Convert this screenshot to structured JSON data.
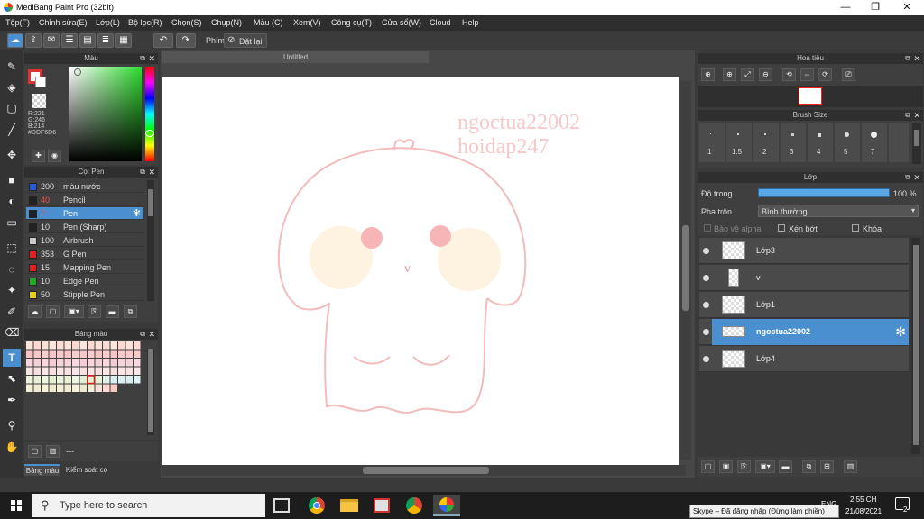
{
  "window": {
    "title": "MediBang Paint Pro (32bit)",
    "min": "—",
    "max": "❐",
    "close": "✕"
  },
  "menu": [
    "Tệp(F)",
    "Chỉnh sửa(E)",
    "Lớp(L)",
    "Bộ lọc(R)",
    "Chọn(S)",
    "Chụp(N)",
    "Màu (C)",
    "Xem(V)",
    "Công cụ(T)",
    "Cửa sổ(W)",
    "Cloud",
    "Help"
  ],
  "toolbar": {
    "keys_label": "Phím",
    "reset_label": "Đặt lại"
  },
  "color_panel": {
    "title": "Màu",
    "r": "R:221",
    "g": "G:246",
    "b": "B:214",
    "hex": "#DDF6D6"
  },
  "brush_panel": {
    "title": "Cọ: Pen",
    "items": [
      {
        "size": "200",
        "name": "màu nước",
        "color": "#2a57d9"
      },
      {
        "size": "40",
        "name": "Pencil",
        "color": "#222222"
      },
      {
        "size": "7",
        "name": "Pen",
        "color": "#222222"
      },
      {
        "size": "10",
        "name": "Pen (Sharp)",
        "color": "#222222"
      },
      {
        "size": "100",
        "name": "Airbrush",
        "color": "#cccccc"
      },
      {
        "size": "353",
        "name": "G Pen",
        "color": "#e02020"
      },
      {
        "size": "15",
        "name": "Mapping Pen",
        "color": "#e02020"
      },
      {
        "size": "10",
        "name": "Edge Pen",
        "color": "#22aa22"
      },
      {
        "size": "50",
        "name": "Stipple Pen",
        "color": "#e8d020"
      }
    ]
  },
  "palette_panel": {
    "title": "Bảng màu",
    "name_field": "---",
    "tab1": "Bảng màu",
    "tab2": "Kiểm soát cọ"
  },
  "canvas": {
    "tab_title": "Untitled",
    "watermark1": "ngoctua22002",
    "watermark2": "hoidap247",
    "face_mark": "v"
  },
  "navigator": {
    "title": "Hoa tiêu"
  },
  "brush_size": {
    "title": "Brush Size",
    "sizes": [
      "1",
      "1.5",
      "2",
      "3",
      "4",
      "5",
      "7"
    ]
  },
  "layer_panel": {
    "title": "Lớp",
    "opacity_label": "Độ trong",
    "opacity_value": "100 %",
    "blend_label": "Pha trộn",
    "blend_value": "Bình thường",
    "protect_alpha": "Bảo vệ alpha",
    "clipping": "Xén bớt",
    "lock": "Khóa",
    "layers": [
      "Lớp3",
      "v",
      "Lớp1",
      "ngoctua22002",
      "Lớp4"
    ]
  },
  "taskbar": {
    "search_placeholder": "Type here to search",
    "tooltip": "Skype – Đã đăng nhập (Đừng làm phiền)",
    "time": "2:55 CH",
    "date": "21/08/2021",
    "lang": "ENG",
    "notif_count": "2"
  }
}
